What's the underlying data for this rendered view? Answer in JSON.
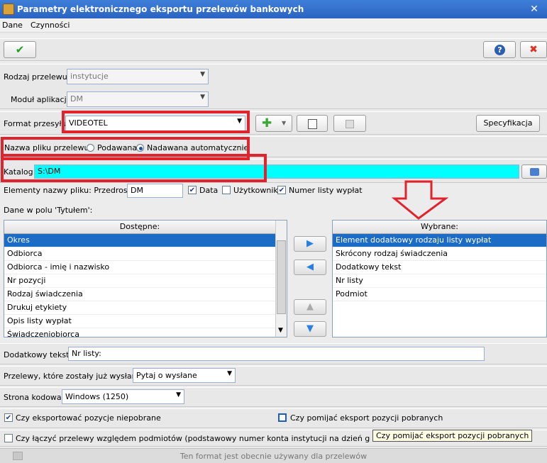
{
  "window": {
    "title": "Parametry elektronicznego eksportu przelewów bankowych",
    "close_glyph": "✕"
  },
  "menu": [
    "Dane",
    "Czynności"
  ],
  "toolbar": {
    "ok_glyph": "✔",
    "help_glyph": "?",
    "cancel_glyph": "✖"
  },
  "rodzaj": {
    "label": "Rodzaj przelewu:",
    "value": "instytucje"
  },
  "modul": {
    "label": "Moduł aplikacji:",
    "value": "DM"
  },
  "format": {
    "label": "Format przesyłu:",
    "value": "VIDEOTEL",
    "add_glyph": "✚",
    "spec_label": "Specyfikacja"
  },
  "nazwa": {
    "label": "Nazwa pliku przelewu:",
    "options": [
      "Podawana",
      "Nadawana automatycznie"
    ],
    "selected": 1
  },
  "katalog": {
    "label": "Katalog:",
    "value": "S:\\DM"
  },
  "elementy": {
    "label": "Elementy nazwy pliku: Przedrostek:",
    "prefix_value": "DM",
    "checks": [
      {
        "label": "Data",
        "checked": true
      },
      {
        "label": "Użytkownik",
        "checked": false
      },
      {
        "label": "Numer listy wypłat",
        "checked": true
      }
    ]
  },
  "tytul": {
    "label": "Dane w polu 'Tytułem':"
  },
  "dostepne": {
    "header": "Dostępne:",
    "items": [
      "Okres",
      "Odbiorca",
      "Odbiorca - imię i nazwisko",
      "Nr pozycji",
      "Rodzaj świadczenia",
      "Drukuj etykiety",
      "Opis listy wypłat",
      "Świadczeniobiorca"
    ]
  },
  "wybrane": {
    "header": "Wybrane:",
    "items": [
      "Element dodatkowy rodzaju listy wypłat",
      "Skrócony rodzaj świadczenia",
      "Dodatkowy tekst",
      "Nr listy",
      "Podmiot"
    ]
  },
  "transfer": {
    "add": "▶",
    "remove": "◀",
    "up": "▲",
    "down": "▼"
  },
  "dodatkowy": {
    "label": "Dodatkowy tekst:",
    "value": "Nr listy:"
  },
  "wyslane": {
    "label": "Przelewy, które zostały już wysłane:",
    "value": "Pytaj o wysłane"
  },
  "strona": {
    "label": "Strona kodowa:",
    "value": "Windows (1250)"
  },
  "opt1": {
    "label": "Czy eksportować pozycje niepobrane",
    "checked": true
  },
  "opt2": {
    "label": "Czy pomijać eksport pozycji pobranych",
    "checked": false
  },
  "opt3": {
    "label": "Czy łączyć przelewy względem podmiotów (podstawowy numer konta instytucji na dzień generowania list",
    "checked": false
  },
  "tooltip": "Czy pomijać eksport pozycji pobranych",
  "footer": {
    "text": "Ten format jest obecnie używany dla przelewów"
  },
  "colors": {
    "highlight_red": "#e0232d",
    "katalog_bg": "#00ffff",
    "selection": "#1c6bc4"
  }
}
